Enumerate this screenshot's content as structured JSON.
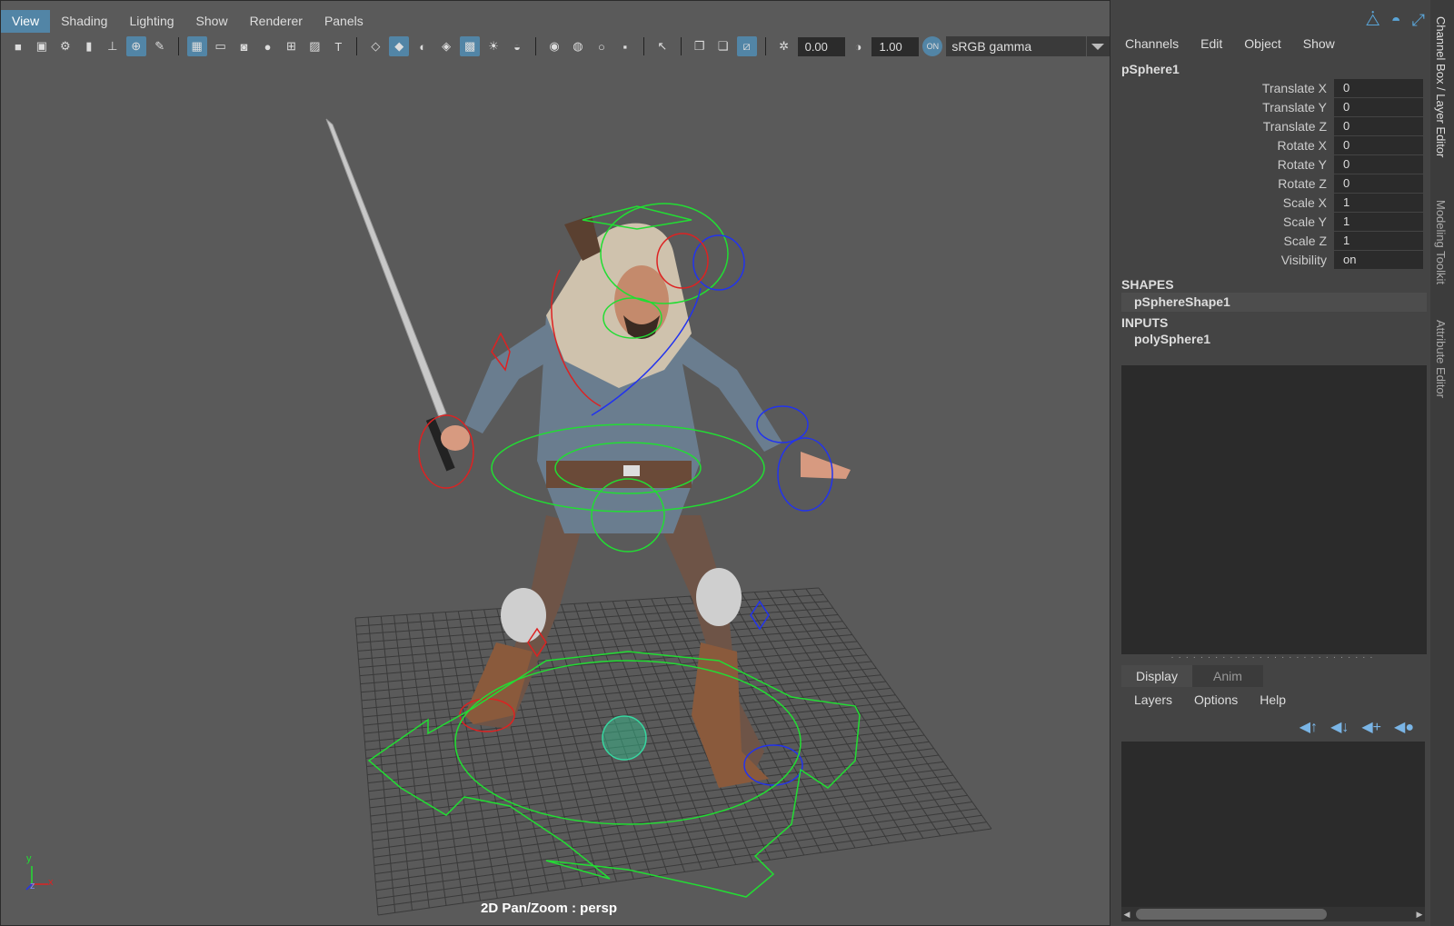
{
  "menubar": {
    "items": [
      "View",
      "Shading",
      "Lighting",
      "Show",
      "Renderer",
      "Panels"
    ]
  },
  "toolbar": {
    "exposure_value": "0.00",
    "gamma_value": "1.00",
    "color_space": "sRGB gamma",
    "icons": [
      "camera-icon",
      "camera-attributes-icon",
      "camera-settings-icon",
      "bookmark-icon",
      "image-plane-icon",
      "grease-pencil-icon",
      "grid-icon",
      "film-gate-icon",
      "resolution-gate-icon",
      "gate-mask-icon",
      "field-chart-icon",
      "safe-action-icon",
      "safe-title-icon",
      "wireframe-icon",
      "smooth-shade-icon",
      "default-material-icon",
      "textured-icon",
      "xray-icon",
      "lights-icon",
      "shadows-icon",
      "ambient-occlusion-icon",
      "motion-blur-icon",
      "antialiasing-icon",
      "depth-of-field-icon",
      "isolate-select-icon",
      "xray-joints-icon",
      "xray-active-icon",
      "backface-icon",
      "exposure-icon",
      "gamma-icon",
      "color-management-icon"
    ]
  },
  "scene": {
    "camera_label": "2D Pan/Zoom : persp",
    "axis_labels": {
      "y": "y",
      "z": "z",
      "x": "x"
    }
  },
  "channel_box": {
    "tabs_menu": [
      "Channels",
      "Edit",
      "Object",
      "Show"
    ],
    "node_name": "pSphere1",
    "channels": [
      {
        "label": "Translate X",
        "value": "0"
      },
      {
        "label": "Translate Y",
        "value": "0"
      },
      {
        "label": "Translate Z",
        "value": "0"
      },
      {
        "label": "Rotate X",
        "value": "0"
      },
      {
        "label": "Rotate Y",
        "value": "0"
      },
      {
        "label": "Rotate Z",
        "value": "0"
      },
      {
        "label": "Scale X",
        "value": "1"
      },
      {
        "label": "Scale Y",
        "value": "1"
      },
      {
        "label": "Scale Z",
        "value": "1"
      },
      {
        "label": "Visibility",
        "value": "on"
      }
    ],
    "shapes_header": "SHAPES",
    "shape_item": "pSphereShape1",
    "inputs_header": "INPUTS",
    "input_item": "polySphere1"
  },
  "layer_editor": {
    "tabs": [
      "Display",
      "Anim"
    ],
    "menu": [
      "Layers",
      "Options",
      "Help"
    ]
  },
  "vertical_tabs": [
    "Channel Box / Layer Editor",
    "Modeling Toolkit",
    "Attribute Editor"
  ],
  "colors": {
    "accent": "#5285a6",
    "viewport_bg": "#5a5a5a",
    "panel_bg": "#444444",
    "rig_green": "#22dd33",
    "rig_red": "#dd2222",
    "rig_blue": "#2233ee"
  }
}
